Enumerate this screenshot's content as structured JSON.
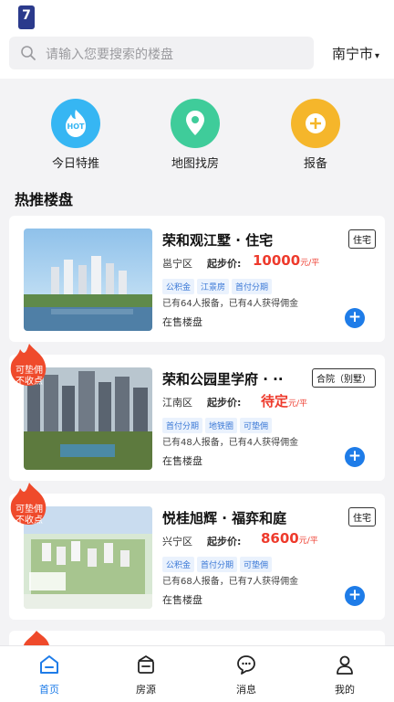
{
  "header": {
    "logo_text": "7",
    "search_placeholder": "请输入您要搜索的楼盘",
    "city": "南宁市",
    "city_caret": "▾"
  },
  "quick_actions": [
    {
      "label": "今日特推",
      "badge": "HOT",
      "icon": "hot-icon",
      "color": "#36b6f3"
    },
    {
      "label": "地图找房",
      "icon": "map-pin-icon",
      "color": "#3fcc9a"
    },
    {
      "label": "报备",
      "icon": "plus-icon",
      "color": "#f5b62b"
    }
  ],
  "section_title": "热推楼盘",
  "listings": [
    {
      "name": "荣和观江墅 · 住宅",
      "type": "住宅",
      "district": "邕宁区",
      "price_label": "起步价:",
      "price": "10000",
      "price_unit": "元/平",
      "tags": [
        "公积金",
        "江景房",
        "首付分期"
      ],
      "stats": "已有64人报备，已有4人获得佣金",
      "status": "在售楼盘",
      "promo": null
    },
    {
      "name": "荣和公园里学府 · ··",
      "type": "合院（别墅）",
      "district": "江南区",
      "price_label": "起步价:",
      "price": "待定",
      "price_unit": "元/平",
      "tags": [
        "首付分期",
        "地铁圈",
        "可垫佣"
      ],
      "stats": "已有48人报备，已有4人获得佣金",
      "status": "在售楼盘",
      "promo": {
        "line1": "可垫佣",
        "line2": "不收点"
      }
    },
    {
      "name": "悦桂旭辉 · 福弈和庭",
      "type": "住宅",
      "district": "兴宁区",
      "price_label": "起步价:",
      "price": "8600",
      "price_unit": "元/平",
      "tags": [
        "公积金",
        "首付分期",
        "可垫佣"
      ],
      "stats": "已有68人报备，已有7人获得佣金",
      "status": "在售楼盘",
      "promo": {
        "line1": "可垫佣",
        "line2": "不收点"
      }
    }
  ],
  "add_symbol": "+",
  "tabs": [
    {
      "label": "首页",
      "icon": "home-icon",
      "active": true
    },
    {
      "label": "房源",
      "icon": "house-icon",
      "active": false
    },
    {
      "label": "消息",
      "icon": "message-icon",
      "active": false
    },
    {
      "label": "我的",
      "icon": "user-icon",
      "active": false
    }
  ]
}
